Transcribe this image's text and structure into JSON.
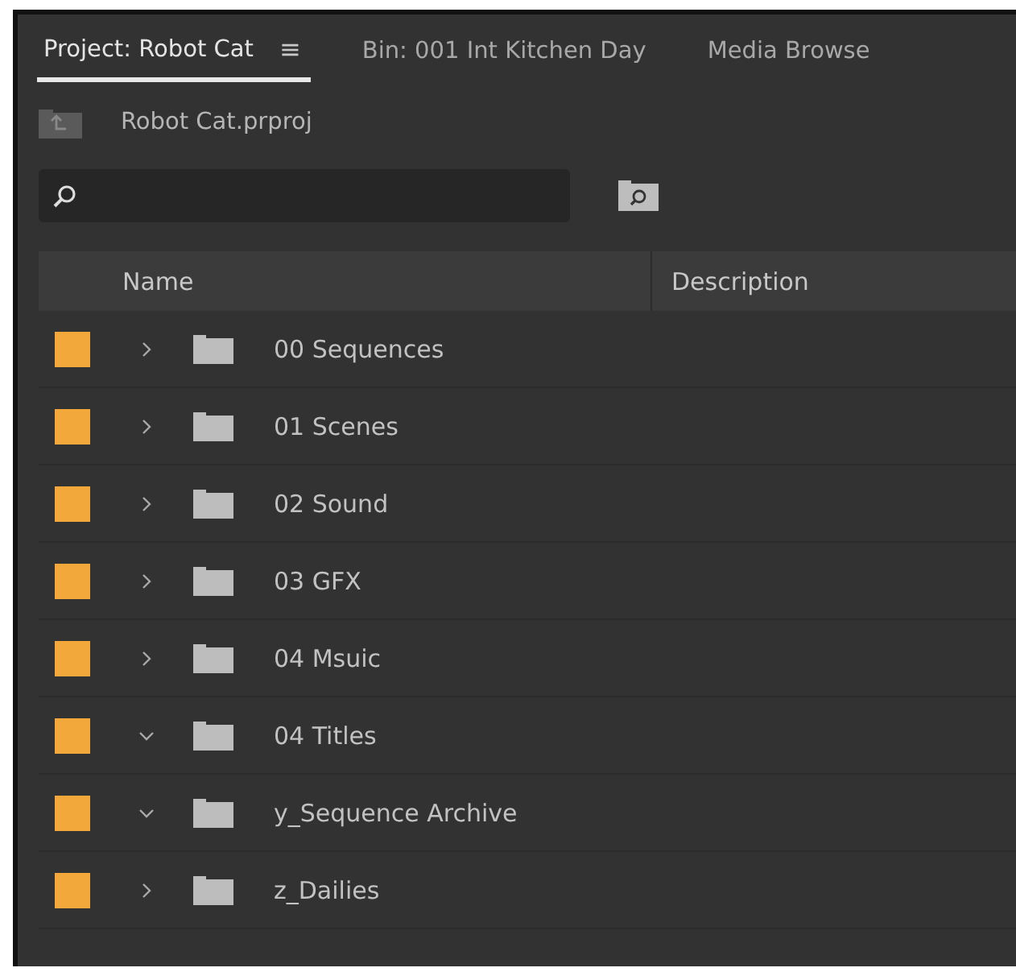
{
  "tabs": [
    {
      "label": "Project: Robot Cat",
      "selected": true,
      "menu_icon": "≡"
    },
    {
      "label": "Bin: 001 Int Kitchen Day",
      "selected": false
    },
    {
      "label": "Media Browse",
      "selected": false
    }
  ],
  "project": {
    "name": "Robot Cat.prproj"
  },
  "table": {
    "columns": [
      "Name",
      "Description"
    ],
    "rows": [
      {
        "name": "00 Sequences",
        "color": "#f2a83b",
        "expanded": false
      },
      {
        "name": "01 Scenes",
        "color": "#f2a83b",
        "expanded": false
      },
      {
        "name": "02 Sound",
        "color": "#f2a83b",
        "expanded": false
      },
      {
        "name": "03 GFX",
        "color": "#f2a83b",
        "expanded": false
      },
      {
        "name": "04 Msuic",
        "color": "#f2a83b",
        "expanded": false
      },
      {
        "name": "04 Titles",
        "color": "#f2a83b",
        "expanded": true
      },
      {
        "name": "y_Sequence Archive",
        "color": "#f2a83b",
        "expanded": true
      },
      {
        "name": "z_Dailies",
        "color": "#f2a83b",
        "expanded": false
      }
    ]
  }
}
